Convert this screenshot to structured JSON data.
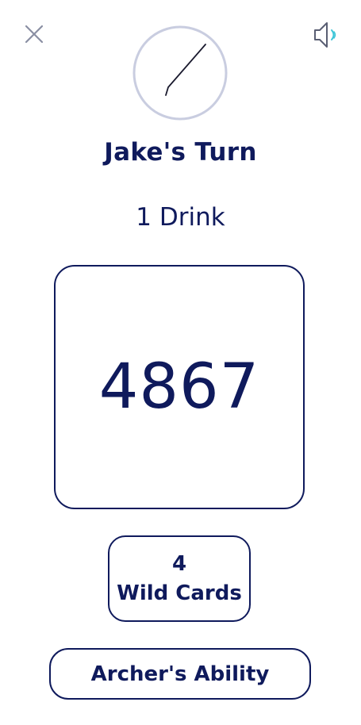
{
  "header": {
    "close_icon": "close-icon",
    "sound_icon": "speaker-icon"
  },
  "timer": {
    "icon": "clock-hand",
    "color": "#c9cde0"
  },
  "turn": {
    "title": "Jake's Turn",
    "drinks": "1 Drink"
  },
  "card": {
    "number": "4867"
  },
  "wild_cards": {
    "count": "4",
    "label": "Wild Cards"
  },
  "ability": {
    "label": "Archer's Ability"
  },
  "colors": {
    "primary": "#0f1a5c",
    "accent": "#3ec6d8",
    "muted": "#8a8fa3"
  }
}
